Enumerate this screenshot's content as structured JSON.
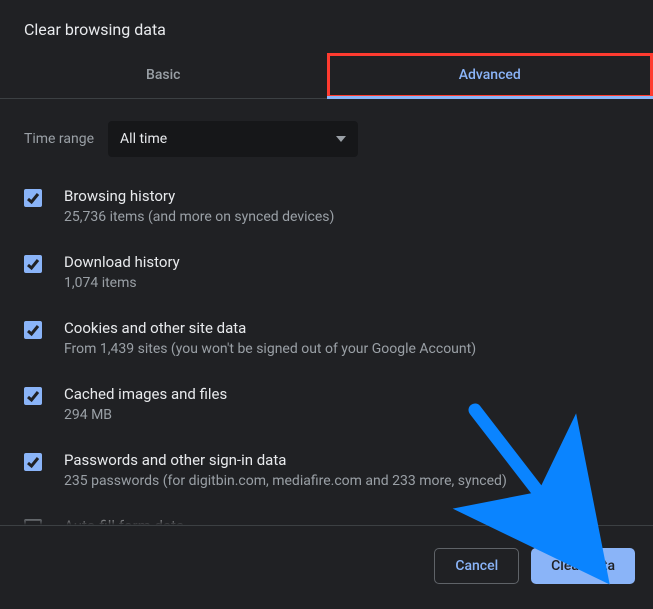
{
  "dialog": {
    "title": "Clear browsing data"
  },
  "tabs": {
    "basic": "Basic",
    "advanced": "Advanced"
  },
  "time_range": {
    "label": "Time range",
    "value": "All time"
  },
  "items": [
    {
      "title": "Browsing history",
      "sub": "25,736 items (and more on synced devices)",
      "checked": true
    },
    {
      "title": "Download history",
      "sub": "1,074 items",
      "checked": true
    },
    {
      "title": "Cookies and other site data",
      "sub": "From 1,439 sites (you won't be signed out of your Google Account)",
      "checked": true
    },
    {
      "title": "Cached images and files",
      "sub": "294 MB",
      "checked": true
    },
    {
      "title": "Passwords and other sign-in data",
      "sub": "235 passwords (for digitbin.com, mediafire.com and 233 more, synced)",
      "checked": true
    },
    {
      "title": "Auto-fill form data",
      "sub": "",
      "checked": false
    }
  ],
  "footer": {
    "cancel": "Cancel",
    "clear": "Clear data"
  }
}
